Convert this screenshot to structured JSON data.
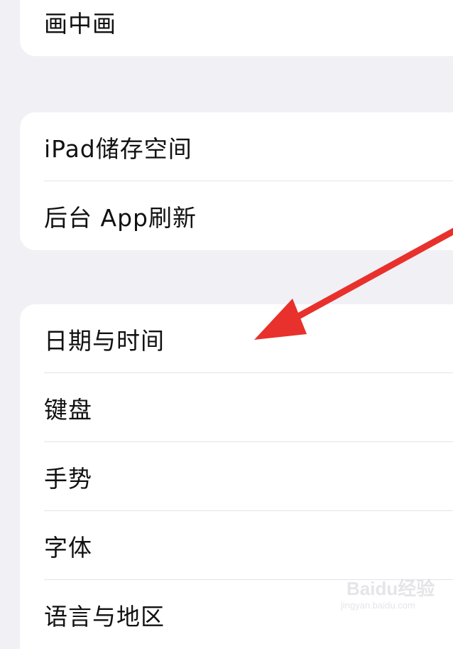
{
  "groups": [
    {
      "items": [
        {
          "label": "画中画"
        }
      ]
    },
    {
      "items": [
        {
          "label": "iPad储存空间"
        },
        {
          "label": "后台 App刷新"
        }
      ]
    },
    {
      "items": [
        {
          "label": "日期与时间"
        },
        {
          "label": "键盘"
        },
        {
          "label": "手势"
        },
        {
          "label": "字体"
        },
        {
          "label": "语言与地区"
        }
      ]
    }
  ],
  "annotation": {
    "arrow_color": "#e8312c",
    "points_to": "日期与时间"
  },
  "watermark": {
    "brand": "Baidu经验",
    "url": "jingyan.baidu.com"
  },
  "colors": {
    "background": "#f0f0f5",
    "card": "#ffffff",
    "text": "#111111",
    "separator": "#e4e4ea"
  }
}
